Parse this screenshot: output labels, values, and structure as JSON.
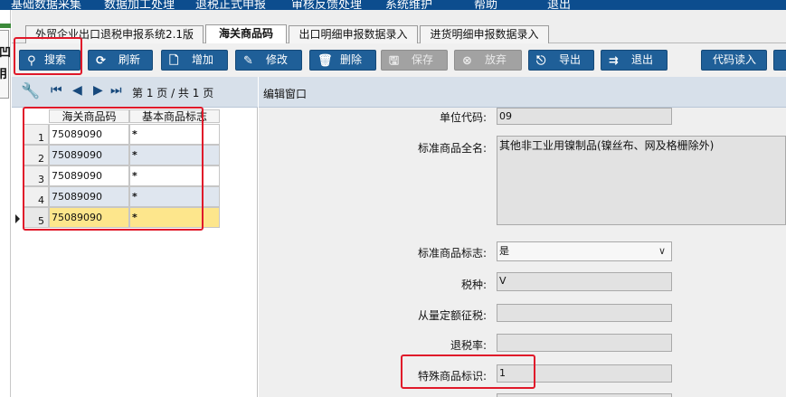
{
  "menu": {
    "items": [
      "基础数据采集",
      "数据加工处理",
      "退税正式申报",
      "审核反馈处理",
      "系统维护",
      "帮助",
      "退出"
    ]
  },
  "sidebar": {
    "button_text": "凹 ⺝"
  },
  "tabs": [
    {
      "label": "外贸企业出口退税申报系统2.1版"
    },
    {
      "label": "海关商品码"
    },
    {
      "label": "出口明细申报数据录入"
    },
    {
      "label": "进货明细申报数据录入"
    }
  ],
  "toolbar": {
    "search": "搜索",
    "refresh": "刷新",
    "add": "增加",
    "edit": "修改",
    "delete": "删除",
    "save": "保存",
    "discard": "放弃",
    "export": "导出",
    "exit": "退出",
    "code_read": "代码读入"
  },
  "pager": {
    "info": "第 1 页 / 共 1 页"
  },
  "grid": {
    "headers": [
      "海关商品码",
      "基本商品标志"
    ],
    "rows": [
      {
        "num": "1",
        "code": "75089090",
        "flag": "*"
      },
      {
        "num": "2",
        "code": "75089090",
        "flag": "*"
      },
      {
        "num": "3",
        "code": "75089090",
        "flag": "*"
      },
      {
        "num": "4",
        "code": "75089090",
        "flag": "*"
      },
      {
        "num": "5",
        "code": "75089090",
        "flag": "*"
      }
    ],
    "selected_row": 5
  },
  "editor": {
    "title": "编辑窗口",
    "fields": {
      "unit_code": {
        "label": "单位代码:",
        "value": "09"
      },
      "std_name": {
        "label": "标准商品全名:",
        "value": "其他非工业用镍制品(镍丝布、网及格栅除外)"
      },
      "std_flag": {
        "label": "标准商品标志:",
        "value": "是"
      },
      "tax_type": {
        "label": "税种:",
        "value": "V"
      },
      "quota_tax": {
        "label": "从量定额征税:",
        "value": ""
      },
      "refund_rate": {
        "label": "退税率:",
        "value": ""
      },
      "special_flag": {
        "label": "特殊商品标识:",
        "value": "1"
      }
    }
  },
  "colors": {
    "menu_bg": "#0c4d8e",
    "button_blue": "#1f5f98",
    "button_disabled": "#a2a2a2",
    "highlight_red": "#e0192a",
    "selected_row": "#fde68c",
    "alt_row": "#dfe6ef",
    "pager_bg": "#d7e0ea"
  }
}
